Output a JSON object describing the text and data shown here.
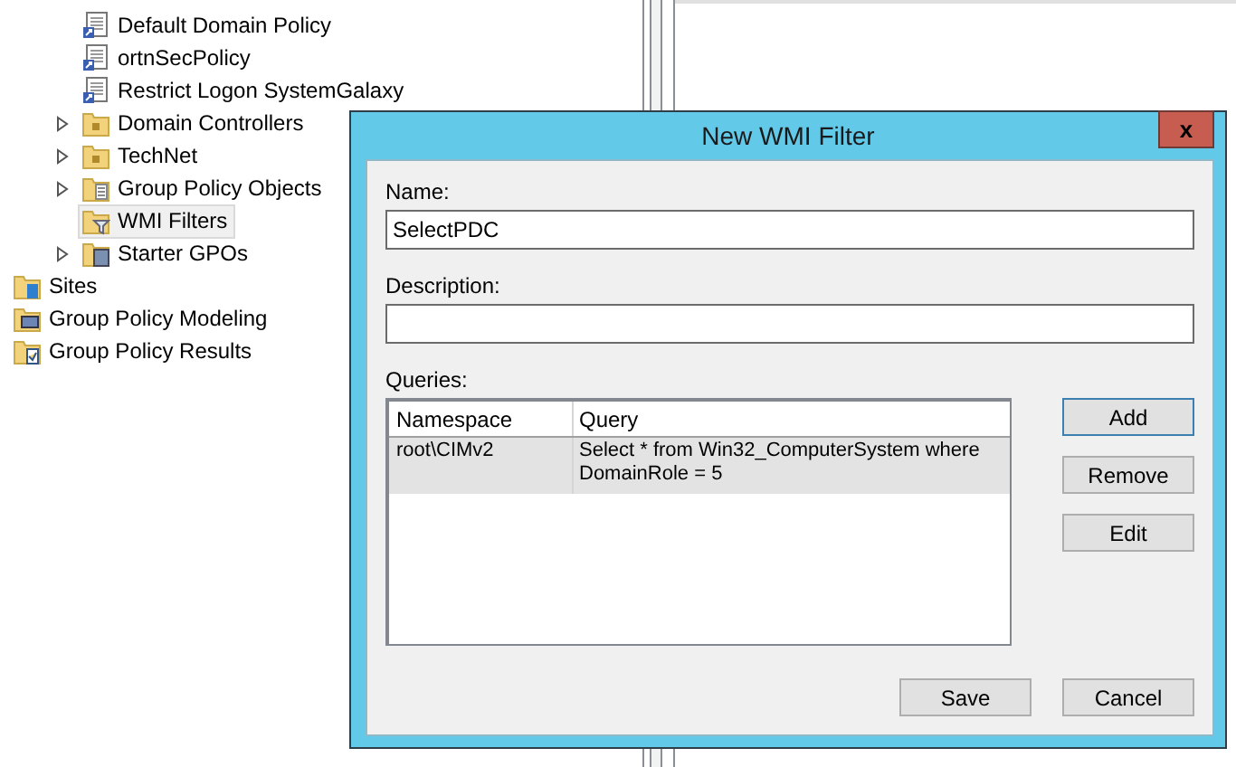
{
  "tree": [
    {
      "children": [
        {
          "label": "Default Domain Policy",
          "kind": "gpo-link",
          "collapsed": false,
          "selected": false
        },
        {
          "label": "ortnSecPolicy",
          "kind": "gpo-link",
          "collapsed": false,
          "selected": false
        },
        {
          "label": "Restrict Logon SystemGalaxy",
          "kind": "gpo-link",
          "collapsed": false,
          "selected": false
        },
        {
          "label": "Domain Controllers",
          "kind": "ou",
          "collapsed": true,
          "selected": false
        },
        {
          "label": "TechNet",
          "kind": "ou",
          "collapsed": true,
          "selected": false
        },
        {
          "label": "Group Policy Objects",
          "kind": "gpo-folder",
          "collapsed": true,
          "selected": false
        },
        {
          "label": "WMI Filters",
          "kind": "wmi-folder",
          "collapsed": false,
          "selected": true
        },
        {
          "label": "Starter GPOs",
          "kind": "starter-folder",
          "collapsed": true,
          "selected": false
        }
      ]
    },
    {
      "label": "Sites",
      "kind": "sites",
      "selected": false
    },
    {
      "label": "Group Policy Modeling",
      "kind": "modeling",
      "selected": false
    },
    {
      "label": "Group Policy Results",
      "kind": "results",
      "selected": false
    }
  ],
  "dialog": {
    "title": "New WMI Filter",
    "close": "x",
    "name": {
      "label": "Name:",
      "value": "SelectPDC"
    },
    "description": {
      "label": "Description:"
    },
    "queries": {
      "label": "Queries:",
      "columns": [
        "Namespace",
        "Query"
      ],
      "rows": [
        {
          "cells": [
            "root\\CIMv2",
            "Select * from Win32_ComputerSystem where DomainRole = 5"
          ],
          "selected": true
        }
      ]
    },
    "side_buttons": [
      {
        "label": "Add",
        "default": true
      },
      {
        "label": "Remove",
        "default": false
      },
      {
        "label": "Edit",
        "default": false
      }
    ],
    "bottom_buttons": [
      {
        "label": "Save",
        "default": false
      },
      {
        "label": "Cancel",
        "default": false
      }
    ]
  }
}
